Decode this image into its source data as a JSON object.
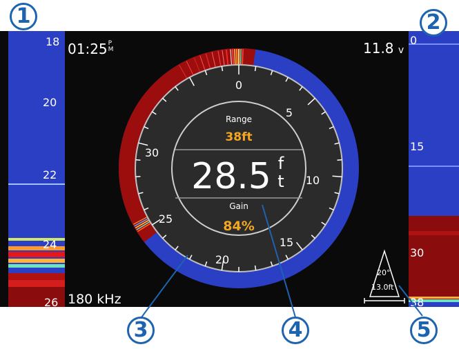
{
  "colors": {
    "sonar_blue": "#2b3fc4",
    "sonar_red": "#9c0d0d",
    "dial_bg": "#2b2b2b",
    "accent_orange": "#f5a623",
    "callout_blue": "#1d63ae"
  },
  "status": {
    "time": "01:25",
    "ampm": "PM",
    "voltage": "11.8",
    "voltage_unit": "v",
    "frequency": "180 kHz"
  },
  "left_scale": [
    "18",
    "20",
    "22",
    "24",
    "26"
  ],
  "right_scale": [
    "0",
    "15",
    "30",
    "38"
  ],
  "dial": {
    "range_label": "Range",
    "range_value": "38ft",
    "depth_value": "28.5",
    "depth_unit_top": "f",
    "depth_unit_bottom": "t",
    "gain_label": "Gain",
    "gain_value": "84%",
    "ticks": [
      "0",
      "5",
      "10",
      "15",
      "20",
      "25",
      "30"
    ]
  },
  "transducer": {
    "angle": "20°",
    "depth": "13.0ft",
    "icon": "transducer-cone-icon"
  },
  "callouts": [
    "1",
    "2",
    "3",
    "4",
    "5"
  ]
}
